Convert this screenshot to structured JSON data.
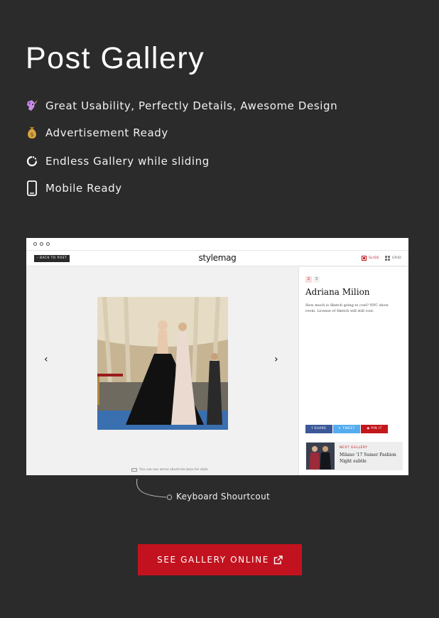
{
  "page": {
    "title": "Post Gallery"
  },
  "features": [
    {
      "icon": "unicorn-emoji-icon",
      "text": "Great Usability, Perfectly Details, Awesome Design"
    },
    {
      "icon": "money-bag-emoji-icon",
      "text": "Advertisement Ready"
    },
    {
      "icon": "loop-ring-icon",
      "text": "Endless Gallery while sliding"
    },
    {
      "icon": "mobile-phone-icon",
      "text": "Mobile Ready"
    }
  ],
  "mockup": {
    "back_label": "‹ BACK TO POST",
    "logo": "stylemag",
    "slide_label": "SLIDE",
    "grid_label": "GRID",
    "prev_arrow": "‹",
    "next_arrow": "›",
    "keyboard_hint": "You can use arrow shortcuts keys for slide",
    "pager": [
      "2",
      "3"
    ],
    "model_name": "Adriana Milion",
    "model_desc": "How much is Sketch going to cost? NYC show room. License of Sketch will still cost.",
    "share": {
      "facebook": "f SHARE",
      "twitter": "TWEET",
      "pinterest": "PIN IT"
    },
    "next_gallery_label": "NEXT GALLERY",
    "next_gallery_title": "Milano '17 Sumer Fashion Night subtle"
  },
  "callout": {
    "label": "Keyboard Shourtcout"
  },
  "cta": {
    "label": "SEE GALLERY ONLINE"
  },
  "colors": {
    "background": "#2b2b2c",
    "accent": "#c3121f",
    "facebook": "#3b5998",
    "twitter": "#55acee",
    "pinterest": "#c4161c"
  }
}
